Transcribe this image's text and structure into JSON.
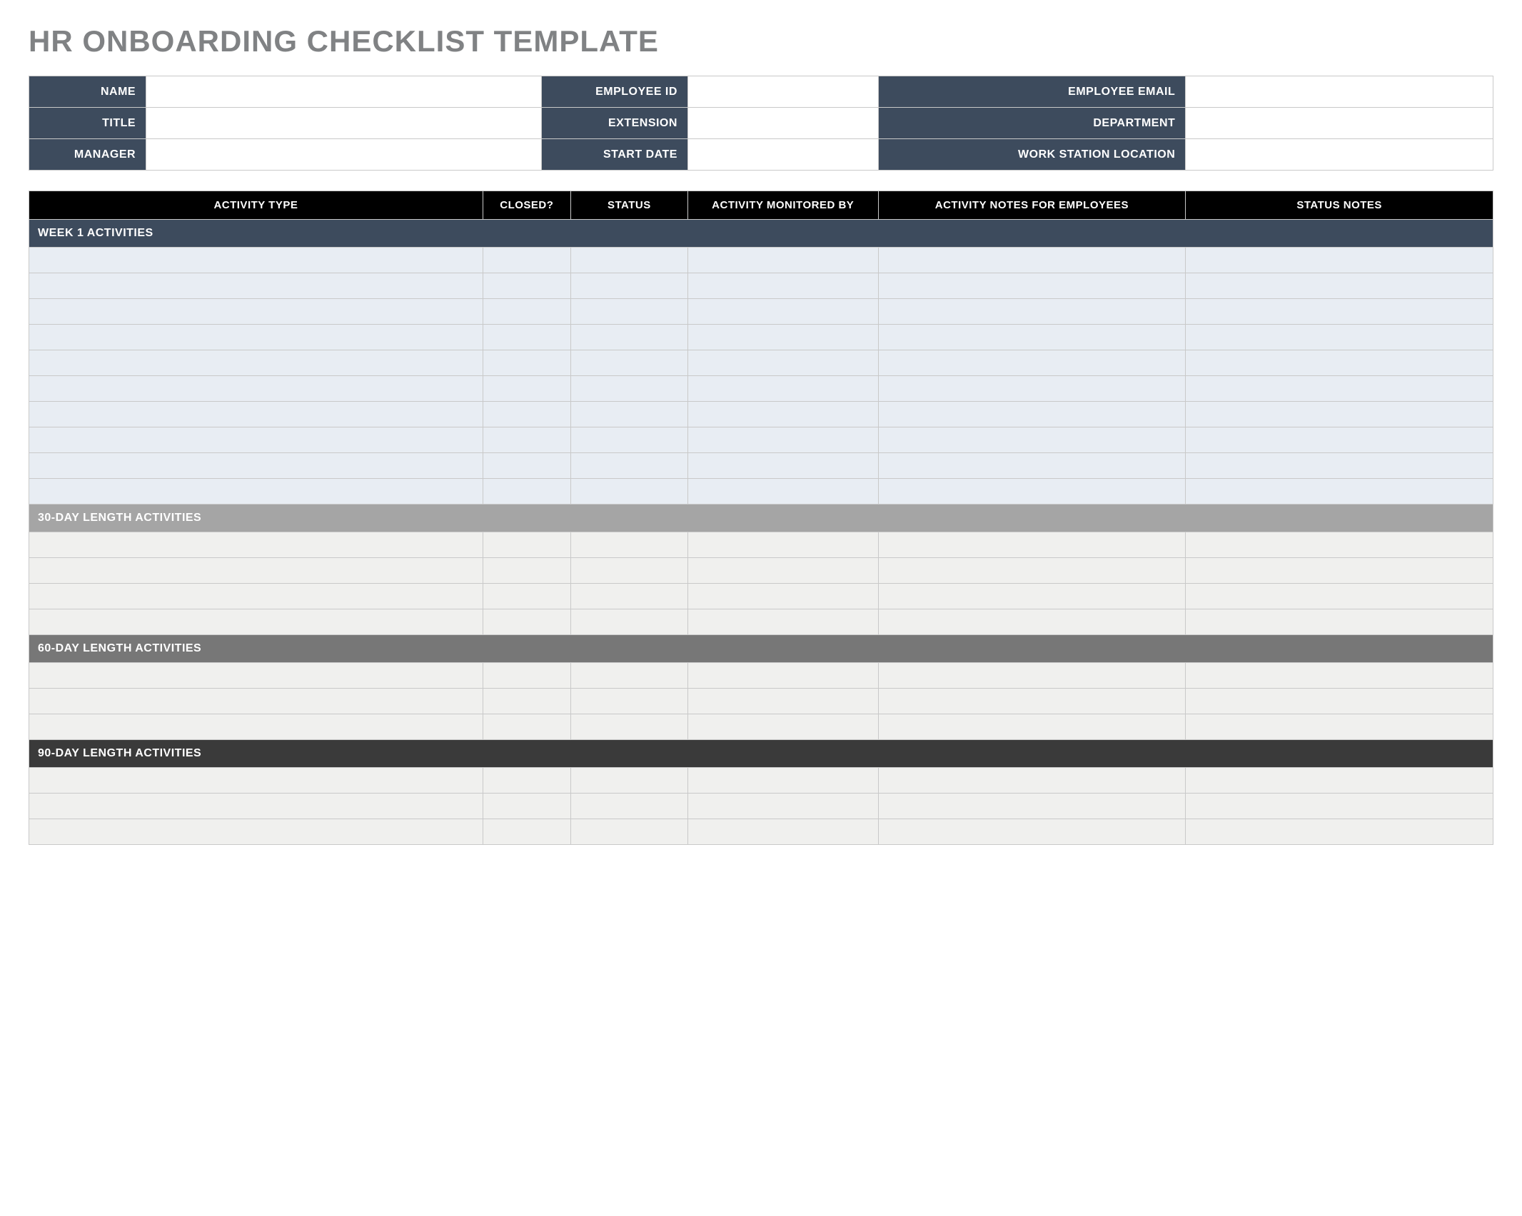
{
  "title": "HR ONBOARDING CHECKLIST TEMPLATE",
  "info_rows": [
    [
      {
        "label": "NAME",
        "value": ""
      },
      {
        "label": "EMPLOYEE ID",
        "value": ""
      },
      {
        "label": "EMPLOYEE EMAIL",
        "value": ""
      }
    ],
    [
      {
        "label": "TITLE",
        "value": ""
      },
      {
        "label": "EXTENSION",
        "value": ""
      },
      {
        "label": "DEPARTMENT",
        "value": ""
      }
    ],
    [
      {
        "label": "MANAGER",
        "value": ""
      },
      {
        "label": "START DATE",
        "value": ""
      },
      {
        "label": "WORK STATION LOCATION",
        "value": ""
      }
    ]
  ],
  "columns": [
    "ACTIVITY TYPE",
    "CLOSED?",
    "STATUS",
    "ACTIVITY MONITORED BY",
    "ACTIVITY NOTES FOR EMPLOYEES",
    "STATUS NOTES"
  ],
  "sections": [
    {
      "title": "WEEK 1 ACTIVITIES",
      "style": "dark",
      "row_style": "blue",
      "rows": [
        {
          "activity_type": "",
          "closed": "",
          "status": "",
          "monitored_by": "",
          "notes": "",
          "status_notes": ""
        },
        {
          "activity_type": "",
          "closed": "",
          "status": "",
          "monitored_by": "",
          "notes": "",
          "status_notes": ""
        },
        {
          "activity_type": "",
          "closed": "",
          "status": "",
          "monitored_by": "",
          "notes": "",
          "status_notes": ""
        },
        {
          "activity_type": "",
          "closed": "",
          "status": "",
          "monitored_by": "",
          "notes": "",
          "status_notes": ""
        },
        {
          "activity_type": "",
          "closed": "",
          "status": "",
          "monitored_by": "",
          "notes": "",
          "status_notes": ""
        },
        {
          "activity_type": "",
          "closed": "",
          "status": "",
          "monitored_by": "",
          "notes": "",
          "status_notes": ""
        },
        {
          "activity_type": "",
          "closed": "",
          "status": "",
          "monitored_by": "",
          "notes": "",
          "status_notes": ""
        },
        {
          "activity_type": "",
          "closed": "",
          "status": "",
          "monitored_by": "",
          "notes": "",
          "status_notes": ""
        },
        {
          "activity_type": "",
          "closed": "",
          "status": "",
          "monitored_by": "",
          "notes": "",
          "status_notes": ""
        },
        {
          "activity_type": "",
          "closed": "",
          "status": "",
          "monitored_by": "",
          "notes": "",
          "status_notes": ""
        }
      ]
    },
    {
      "title": "30-DAY LENGTH ACTIVITIES",
      "style": "grey1",
      "row_style": "lgrey",
      "rows": [
        {
          "activity_type": "",
          "closed": "",
          "status": "",
          "monitored_by": "",
          "notes": "",
          "status_notes": ""
        },
        {
          "activity_type": "",
          "closed": "",
          "status": "",
          "monitored_by": "",
          "notes": "",
          "status_notes": ""
        },
        {
          "activity_type": "",
          "closed": "",
          "status": "",
          "monitored_by": "",
          "notes": "",
          "status_notes": ""
        },
        {
          "activity_type": "",
          "closed": "",
          "status": "",
          "monitored_by": "",
          "notes": "",
          "status_notes": ""
        }
      ]
    },
    {
      "title": "60-DAY LENGTH ACTIVITIES",
      "style": "grey2",
      "row_style": "lgrey",
      "rows": [
        {
          "activity_type": "",
          "closed": "",
          "status": "",
          "monitored_by": "",
          "notes": "",
          "status_notes": ""
        },
        {
          "activity_type": "",
          "closed": "",
          "status": "",
          "monitored_by": "",
          "notes": "",
          "status_notes": ""
        },
        {
          "activity_type": "",
          "closed": "",
          "status": "",
          "monitored_by": "",
          "notes": "",
          "status_notes": ""
        }
      ]
    },
    {
      "title": "90-DAY LENGTH ACTIVITIES",
      "style": "grey3",
      "row_style": "lgrey",
      "rows": [
        {
          "activity_type": "",
          "closed": "",
          "status": "",
          "monitored_by": "",
          "notes": "",
          "status_notes": ""
        },
        {
          "activity_type": "",
          "closed": "",
          "status": "",
          "monitored_by": "",
          "notes": "",
          "status_notes": ""
        },
        {
          "activity_type": "",
          "closed": "",
          "status": "",
          "monitored_by": "",
          "notes": "",
          "status_notes": ""
        }
      ]
    }
  ]
}
